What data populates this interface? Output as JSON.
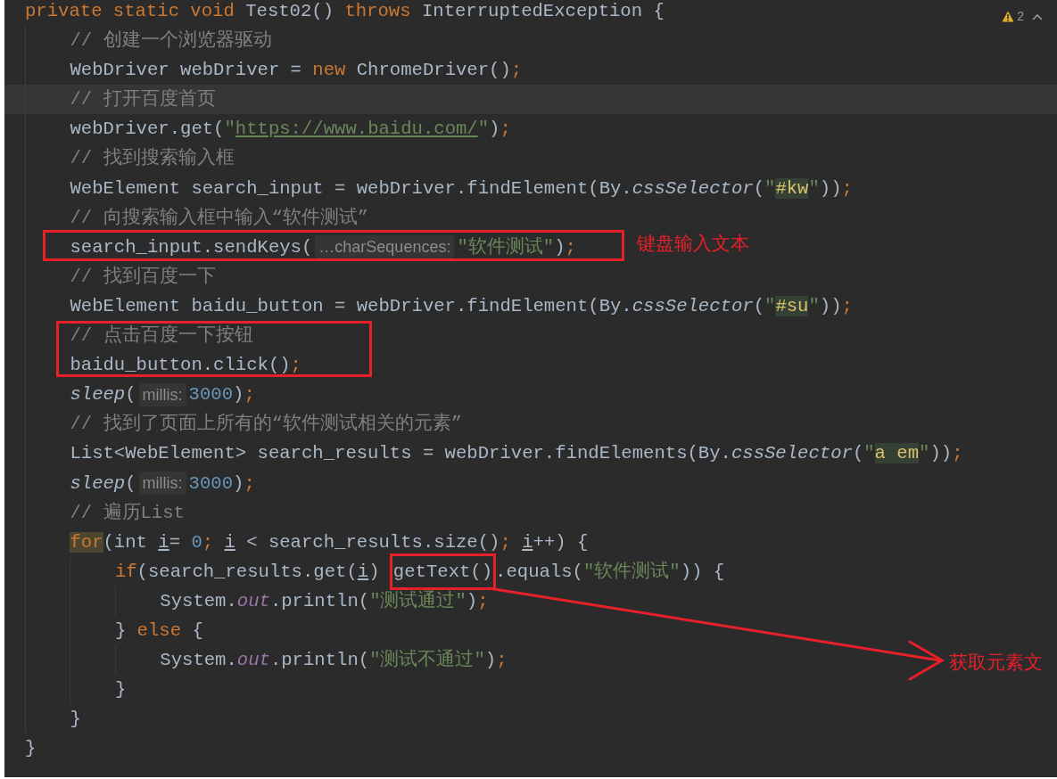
{
  "editor": {
    "lines": [
      {
        "tokens": [
          {
            "kind": "kw",
            "text": "private static void"
          },
          {
            "kind": "p",
            "text": " Test02() "
          },
          {
            "kind": "kw",
            "text": "throws"
          },
          {
            "kind": "p",
            "text": " InterruptedException {"
          }
        ],
        "children": [
          {
            "tokens": [
              {
                "kind": "c",
                "text": "// 创建一个浏览器驱动"
              }
            ]
          },
          {
            "tokens": [
              {
                "kind": "p",
                "text": "WebDriver webDriver = "
              },
              {
                "kind": "kw",
                "text": "new"
              },
              {
                "kind": "p",
                "text": " ChromeDriver()"
              },
              {
                "kind": "kw",
                "text": ";"
              }
            ]
          },
          {
            "current": true,
            "tokens": [
              {
                "kind": "c",
                "text": "// 打开百度首页"
              }
            ]
          },
          {
            "tokens": [
              {
                "kind": "p",
                "text": "webDriver.get("
              },
              {
                "kind": "s",
                "text": "\""
              },
              {
                "kind": "url",
                "text": "https://www.baidu.com/"
              },
              {
                "kind": "s",
                "text": "\""
              },
              {
                "kind": "p",
                "text": ")"
              },
              {
                "kind": "kw",
                "text": ";"
              }
            ]
          },
          {
            "tokens": [
              {
                "kind": "c",
                "text": "// 找到搜索输入框"
              }
            ]
          },
          {
            "tokens": [
              {
                "kind": "p",
                "text": "WebElement search_input = webDriver.findElement(By."
              },
              {
                "kind": "it",
                "text": "cssSelector"
              },
              {
                "kind": "p",
                "text": "("
              },
              {
                "kind": "s",
                "text": "\""
              },
              {
                "kind": "match",
                "text": "#kw"
              },
              {
                "kind": "s",
                "text": "\""
              },
              {
                "kind": "p",
                "text": "))"
              },
              {
                "kind": "kw",
                "text": ";"
              }
            ]
          },
          {
            "tokens": [
              {
                "kind": "c",
                "text": "// 向搜索输入框中输入“软件测试”"
              }
            ]
          },
          {
            "tokens": [
              {
                "kind": "p",
                "text": "search_input.sendKeys("
              },
              {
                "kind": "hint",
                "text": "…charSequences:"
              },
              {
                "kind": "s",
                "text": "\"软件测试\""
              },
              {
                "kind": "p",
                "text": ")"
              },
              {
                "kind": "kw",
                "text": ";"
              }
            ]
          },
          {
            "tokens": [
              {
                "kind": "c",
                "text": "// 找到百度一下"
              }
            ]
          },
          {
            "tokens": [
              {
                "kind": "p",
                "text": "WebElement baidu_button = webDriver.findElement(By."
              },
              {
                "kind": "it",
                "text": "cssSelector"
              },
              {
                "kind": "p",
                "text": "("
              },
              {
                "kind": "s",
                "text": "\""
              },
              {
                "kind": "match",
                "text": "#su"
              },
              {
                "kind": "s",
                "text": "\""
              },
              {
                "kind": "p",
                "text": "))"
              },
              {
                "kind": "kw",
                "text": ";"
              }
            ]
          },
          {
            "tokens": [
              {
                "kind": "c",
                "text": "// 点击百度一下按钮"
              }
            ]
          },
          {
            "tokens": [
              {
                "kind": "p",
                "text": "baidu_button.click()"
              },
              {
                "kind": "kw",
                "text": ";"
              }
            ]
          },
          {
            "tokens": [
              {
                "kind": "it",
                "text": "sleep"
              },
              {
                "kind": "p",
                "text": "("
              },
              {
                "kind": "hint",
                "text": "millis:"
              },
              {
                "kind": "n",
                "text": "3000"
              },
              {
                "kind": "p",
                "text": ")"
              },
              {
                "kind": "kw",
                "text": ";"
              }
            ]
          },
          {
            "tokens": [
              {
                "kind": "c",
                "text": "// 找到了页面上所有的“软件测试相关的元素”"
              }
            ]
          },
          {
            "tokens": [
              {
                "kind": "p",
                "text": "List<WebElement> search_results = webDriver.findElements(By."
              },
              {
                "kind": "it",
                "text": "cssSelector"
              },
              {
                "kind": "p",
                "text": "("
              },
              {
                "kind": "s",
                "text": "\""
              },
              {
                "kind": "match",
                "text": "a em"
              },
              {
                "kind": "s",
                "text": "\""
              },
              {
                "kind": "p",
                "text": "))"
              },
              {
                "kind": "kw",
                "text": ";"
              }
            ]
          },
          {
            "tokens": [
              {
                "kind": "it",
                "text": "sleep"
              },
              {
                "kind": "p",
                "text": "("
              },
              {
                "kind": "hint",
                "text": "millis:"
              },
              {
                "kind": "n",
                "text": "3000"
              },
              {
                "kind": "p",
                "text": ")"
              },
              {
                "kind": "kw",
                "text": ";"
              }
            ]
          },
          {
            "tokens": [
              {
                "kind": "c",
                "text": "// 遍历List"
              }
            ]
          },
          {
            "tokens": [
              {
                "kind": "kwmatch",
                "text": "for"
              },
              {
                "kind": "p",
                "text": "(int "
              },
              {
                "kind": "ul",
                "text": "i"
              },
              {
                "kind": "p",
                "text": "= "
              },
              {
                "kind": "n",
                "text": "0"
              },
              {
                "kind": "kw",
                "text": "; "
              },
              {
                "kind": "ul",
                "text": "i"
              },
              {
                "kind": "p",
                "text": " < search_results.size()"
              },
              {
                "kind": "kw",
                "text": "; "
              },
              {
                "kind": "ul",
                "text": "i"
              },
              {
                "kind": "p",
                "text": "++) {"
              }
            ],
            "children": [
              {
                "tokens": [
                  {
                    "kind": "kw",
                    "text": "if"
                  },
                  {
                    "kind": "p",
                    "text": "(search_results.get("
                  },
                  {
                    "kind": "ul",
                    "text": "i"
                  },
                  {
                    "kind": "p",
                    "text": ") "
                  },
                  {
                    "kind": "framed",
                    "text": "getText()"
                  },
                  {
                    "kind": "p",
                    "text": ".equals("
                  },
                  {
                    "kind": "s",
                    "text": "\"软件测试\""
                  },
                  {
                    "kind": "p",
                    "text": ")) {"
                  }
                ],
                "children": [
                  {
                    "tokens": [
                      {
                        "kind": "p",
                        "text": "System."
                      },
                      {
                        "kind": "field",
                        "text": "out"
                      },
                      {
                        "kind": "p",
                        "text": ".println("
                      },
                      {
                        "kind": "s",
                        "text": "\"测试通过\""
                      },
                      {
                        "kind": "p",
                        "text": ")"
                      },
                      {
                        "kind": "kw",
                        "text": ";"
                      }
                    ]
                  }
                ]
              },
              {
                "tokens": [
                  {
                    "kind": "p",
                    "text": "} "
                  },
                  {
                    "kind": "kw",
                    "text": "else"
                  },
                  {
                    "kind": "p",
                    "text": " {"
                  }
                ],
                "children": [
                  {
                    "tokens": [
                      {
                        "kind": "p",
                        "text": "System."
                      },
                      {
                        "kind": "field",
                        "text": "out"
                      },
                      {
                        "kind": "p",
                        "text": ".println("
                      },
                      {
                        "kind": "s",
                        "text": "\"测试不通过\""
                      },
                      {
                        "kind": "p",
                        "text": ")"
                      },
                      {
                        "kind": "kw",
                        "text": ";"
                      }
                    ]
                  }
                ]
              },
              {
                "tokens": [
                  {
                    "kind": "p",
                    "text": "}"
                  }
                ]
              }
            ]
          },
          {
            "tokens": [
              {
                "kind": "p",
                "text": "}"
              }
            ]
          }
        ]
      },
      {
        "tokens": [
          {
            "kind": "p",
            "text": "}"
          }
        ]
      }
    ]
  },
  "inspection_widget": {
    "warning_count": "2"
  },
  "annotations": [
    {
      "kind": "box"
    },
    {
      "kind": "label",
      "text": "键盘输入文本"
    },
    {
      "kind": "box"
    },
    {
      "kind": "arrow"
    },
    {
      "kind": "label",
      "text": "获取元素文"
    }
  ]
}
